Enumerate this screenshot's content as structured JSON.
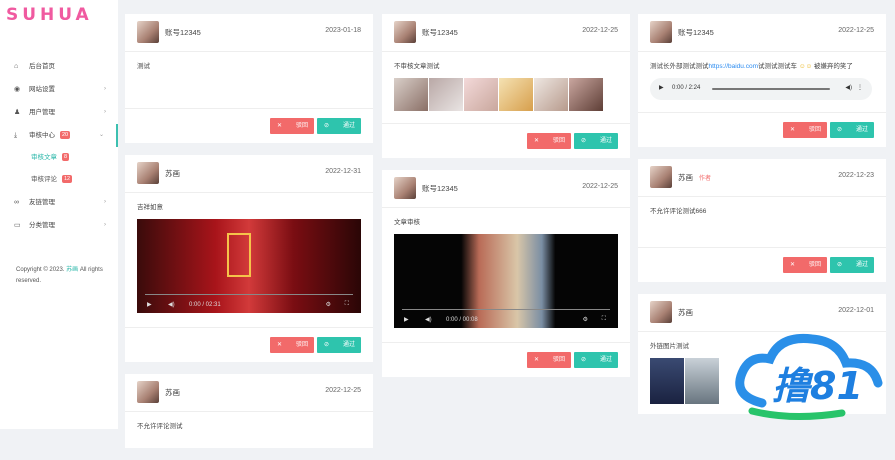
{
  "sidebar": {
    "logo": "SUHUA",
    "items": [
      {
        "icon": "home-icon",
        "label": "后台首页"
      },
      {
        "icon": "globe-icon",
        "label": "网站设置"
      },
      {
        "icon": "users-icon",
        "label": "用户管理"
      },
      {
        "icon": "download-icon",
        "label": "审核中心",
        "badge": "20"
      }
    ],
    "sub": [
      {
        "label": "审核文章",
        "badge": "8"
      },
      {
        "label": "审核评论",
        "badge": "12"
      }
    ],
    "items2": [
      {
        "icon": "link-icon",
        "label": "友链管理"
      },
      {
        "icon": "folder-icon",
        "label": "分类管理"
      }
    ],
    "copyright_a": "Copyright © 2023.",
    "copyright_brand": "苏画",
    "copyright_b": "All rights reserved."
  },
  "buttons": {
    "reject": "驳回",
    "pass": "通过"
  },
  "cards": {
    "c1": {
      "user": "账号12345",
      "date": "2023-01-18",
      "text": "测试"
    },
    "c2": {
      "user": "苏画",
      "date": "2022-12-31",
      "text": "吉祥如意"
    },
    "c3": {
      "user": "苏画",
      "date": "2022-12-25",
      "text": "不允许评论测试"
    },
    "c4": {
      "user": "账号12345",
      "date": "2022-12-25",
      "text": "不审核文章测试"
    },
    "c5": {
      "user": "账号12345",
      "date": "2022-12-25",
      "text": "文章审核"
    },
    "c6": {
      "user": "账号12345",
      "date": "2022-12-25",
      "text_a": "测试长外部测试测试",
      "link": "https://baidu.com",
      "text_b": "试测试测试车",
      "text_c": "被嫌弃的笑了"
    },
    "c7": {
      "user": "苏画",
      "tag": "作者",
      "date": "2022-12-23",
      "text": "不允许评论测试666"
    },
    "c8": {
      "user": "苏画",
      "date": "2022-12-01",
      "text": "外链图片测试"
    }
  },
  "video1": {
    "time": "0:00 / 02:31"
  },
  "video2": {
    "time": "0:00 / 00:08"
  },
  "audio": {
    "time": "0:00 / 2:24"
  },
  "watermark": "撸81"
}
